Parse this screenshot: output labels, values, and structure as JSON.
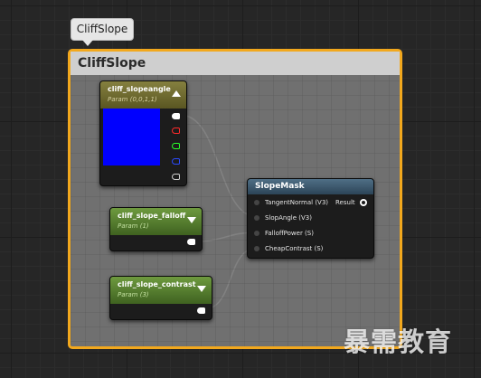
{
  "comment": {
    "bubble_text": "CliffSlope",
    "title": "CliffSlope",
    "frame_color": "#f2a81d"
  },
  "nodes": {
    "slopeangle": {
      "title": "cliff_slopeangle",
      "subtitle": "Param (0,0,1,1)",
      "swatch_color": "#0000ff",
      "collapse_icon": "chevron-up-icon",
      "output_pins": [
        {
          "name": "rgba",
          "color": "#ffffff"
        },
        {
          "name": "r",
          "color": "#ff2a2a"
        },
        {
          "name": "g",
          "color": "#2aff2a"
        },
        {
          "name": "b",
          "color": "#2a4aff"
        },
        {
          "name": "a",
          "color": "#cfcfcf"
        }
      ]
    },
    "falloff": {
      "title": "cliff_slope_falloff",
      "subtitle": "Param (1)",
      "collapse_icon": "chevron-down-icon"
    },
    "contrast": {
      "title": "cliff_slope_contrast",
      "subtitle": "Param (3)",
      "collapse_icon": "chevron-down-icon"
    },
    "slopemask": {
      "title": "SlopeMask",
      "inputs": [
        "TangentNormal (V3)",
        "SlopAngle (V3)",
        "FalloffPower (S)",
        "CheapContrast (S)"
      ],
      "output": "Result"
    }
  },
  "watermark": "暴需教育"
}
